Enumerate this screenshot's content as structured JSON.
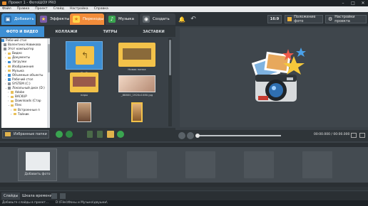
{
  "window": {
    "title": "Проект 1 - ФотоШОУ PRO"
  },
  "menu": [
    "Файл",
    "Правка",
    "Проект",
    "Слайд",
    "Настройка",
    "Справка"
  ],
  "main_tabs": [
    {
      "label": "Добавить"
    },
    {
      "label": "Эффекты"
    },
    {
      "label": "Переходы"
    },
    {
      "label": "Музыка"
    },
    {
      "label": "Создать"
    }
  ],
  "toolbar": {
    "aspect_ratio": "16:9",
    "slide_position": "Положение фото",
    "project_settings": "Настройки проекта"
  },
  "sub_tabs": [
    "ФОТО И ВИДЕО",
    "КОЛЛАЖИ",
    "ТИТРЫ",
    "ЗАСТАВКИ"
  ],
  "tree": [
    "Рабочий стол",
    "Валентина Новикова",
    "Этот компьютер",
    "Видео",
    "Документы",
    "Загрузки",
    "Изображения",
    "Музыка",
    "Объемные объекты",
    "Рабочий стол",
    "SYSTEM (C:)",
    "Локальный диск (D:)",
    "Adobe",
    "BACKUP",
    "Downloads (Стар",
    "Files",
    "Встроенные п",
    "Тайник"
  ],
  "thumbs": [
    {
      "caption": "<...>"
    },
    {
      "caption": "Новая папка"
    },
    {
      "caption": "пары"
    },
    {
      "caption": "_88800_1920x1080.jpg"
    },
    {
      "caption": ""
    },
    {
      "caption": ""
    }
  ],
  "favorites": "Избранные папки",
  "player": {
    "time": "00:00.000 / 00:00.000"
  },
  "timeline": {
    "add_photo": "Добавить фото"
  },
  "footer_tabs": [
    "Слайды",
    "Шкала времени"
  ],
  "status": [
    "Добавьте слайды в проект...",
    "D:\\Files\\Фоны и Музыка\\двушки\\"
  ]
}
